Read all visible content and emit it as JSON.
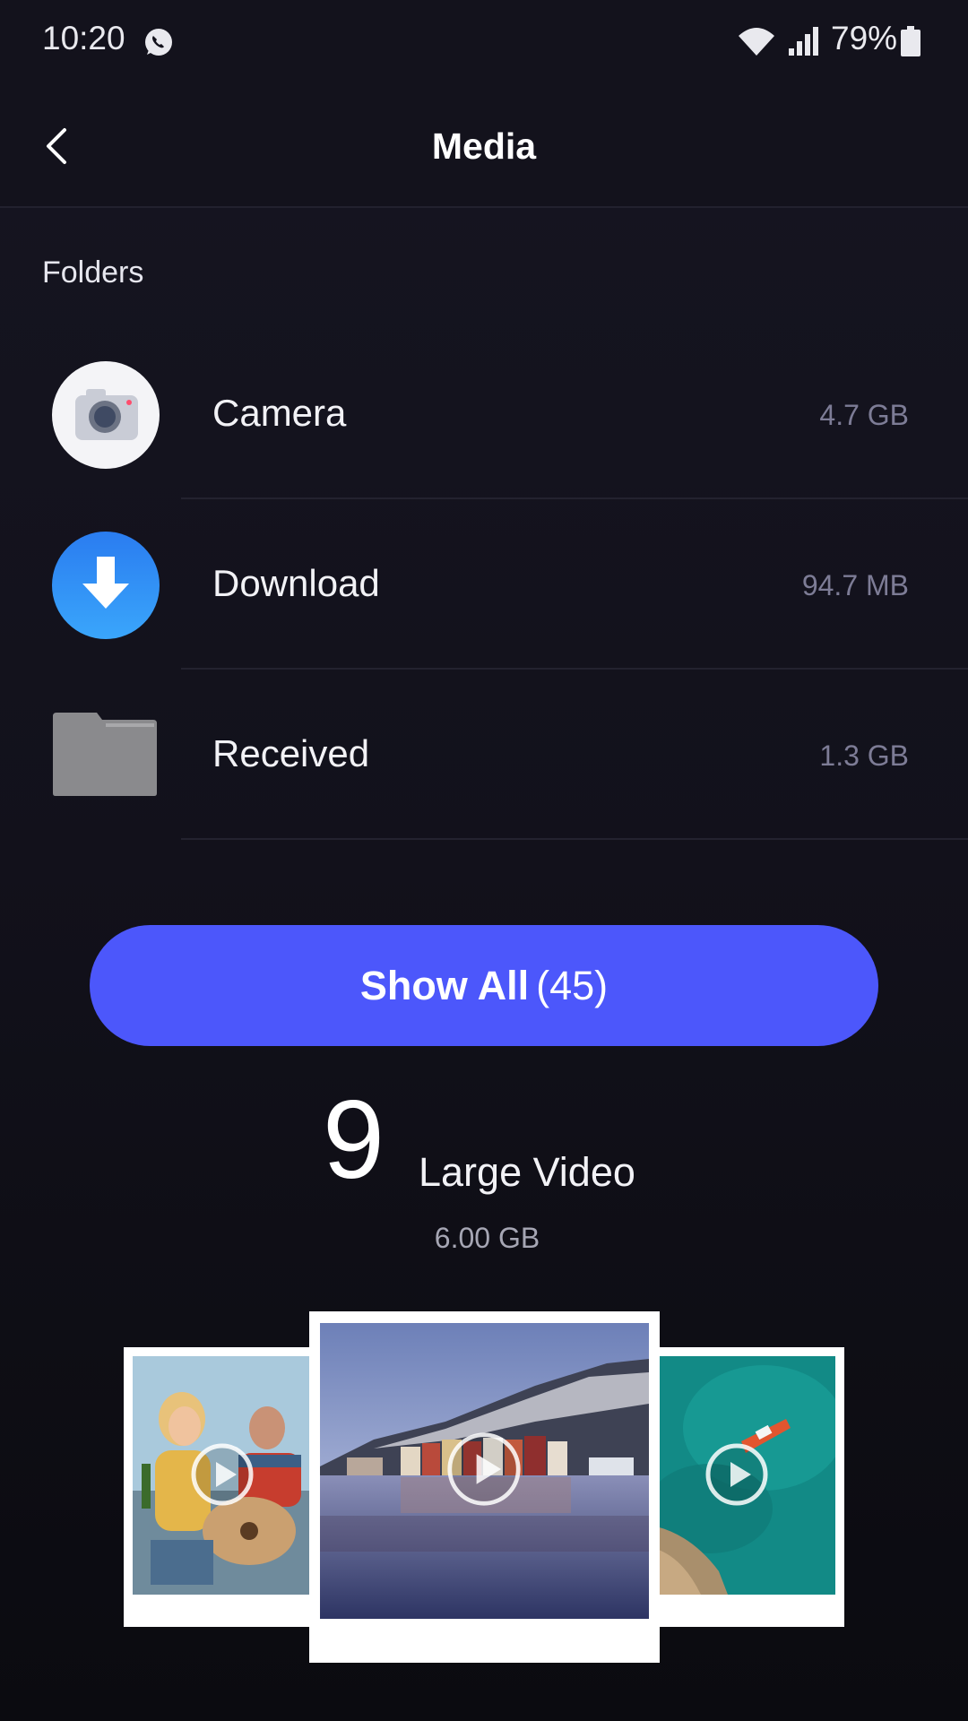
{
  "status_bar": {
    "time": "10:20",
    "battery": "79%",
    "icons": [
      "whatsapp-icon",
      "wifi-icon",
      "signal-icon",
      "battery-icon"
    ]
  },
  "app_bar": {
    "title": "Media",
    "back_icon": "chevron-left-icon"
  },
  "folders": {
    "section_title": "Folders",
    "items": [
      {
        "name": "Camera",
        "size": "4.7 GB",
        "icon": "camera-icon"
      },
      {
        "name": "Download",
        "size": "94.7 MB",
        "icon": "download-icon"
      },
      {
        "name": "Received",
        "size": "1.3 GB",
        "icon": "folder-icon"
      }
    ]
  },
  "show_all": {
    "label": "Show All",
    "count": "(45)"
  },
  "large_video": {
    "count": "9",
    "label": "Large Video",
    "size": "6.00 GB",
    "thumbnails": [
      "friends-guitar-photo",
      "harbor-town-photo",
      "boat-sea-photo"
    ]
  },
  "colors": {
    "accent": "#4c57fb",
    "background": "#13121c",
    "muted_text": "#7d7c96",
    "download_blue": "#2f8ef5"
  }
}
